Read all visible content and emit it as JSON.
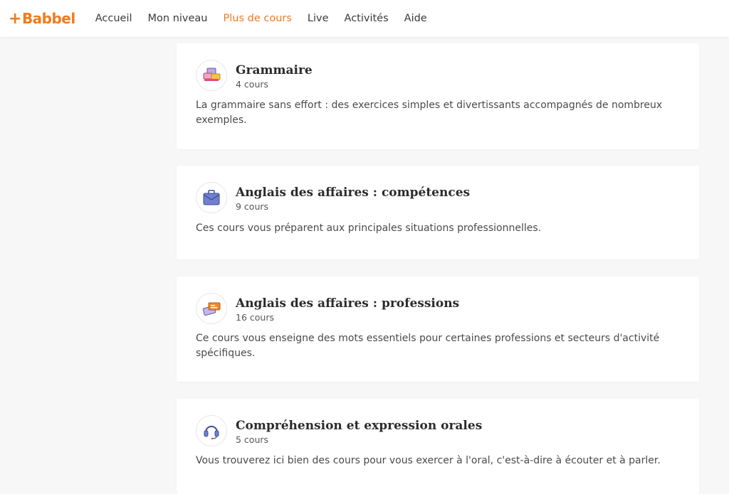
{
  "header": {
    "logo_text": "Babbel",
    "nav": [
      {
        "label": "Accueil"
      },
      {
        "label": "Mon niveau"
      },
      {
        "label": "Plus de cours",
        "active": true
      },
      {
        "label": "Live"
      },
      {
        "label": "Activités"
      },
      {
        "label": "Aide"
      }
    ]
  },
  "colors": {
    "accent": "#f07b1d"
  },
  "courses": [
    {
      "icon": "grammar-blocks-icon",
      "title": "Grammaire",
      "count": "4 cours",
      "description": "La grammaire sans effort : des exercices simples et divertissants accompagnés de nombreux exemples."
    },
    {
      "icon": "briefcase-icon",
      "title": "Anglais des affaires : compétences",
      "count": "9 cours",
      "description": "Ces cours vous préparent aux principales situations professionnelles."
    },
    {
      "icon": "business-cards-icon",
      "title": "Anglais des affaires : professions",
      "count": "16 cours",
      "description": "Ce cours vous enseigne des mots essentiels pour certaines professions et secteurs d'activité spécifiques."
    },
    {
      "icon": "headset-icon",
      "title": "Compréhension et expression orales",
      "count": "5 cours",
      "description": "Vous trouverez ici bien des cours pour vous exercer à l'oral, c'est-à-dire à écouter et à parler."
    }
  ]
}
